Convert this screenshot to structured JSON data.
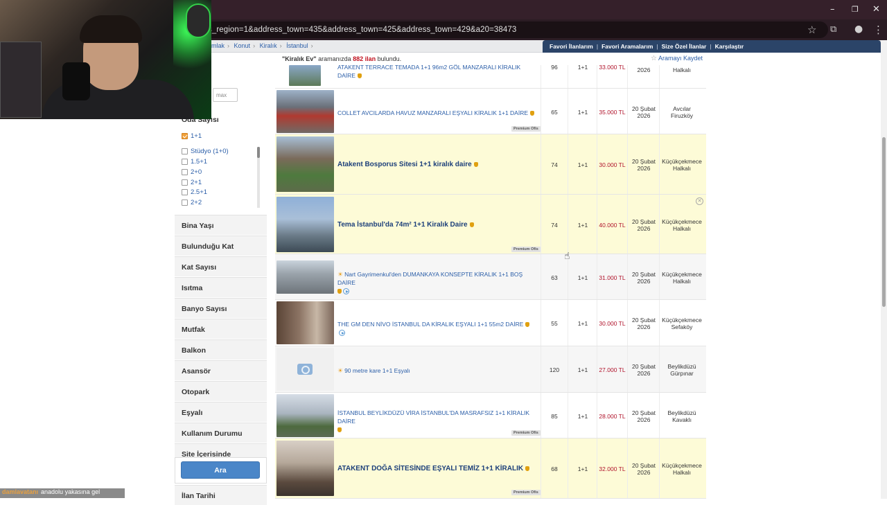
{
  "browser": {
    "url": "s_region=1&address_town=435&address_town=425&address_town=429&a20=38473",
    "icons": [
      "star-icon",
      "extensions-icon",
      "profile-icon",
      "menu-icon"
    ]
  },
  "breadcrumb": [
    "mlak",
    "Konut",
    "Kiralık",
    "İstanbul"
  ],
  "toplinks": [
    "Favori İlanlarım",
    "Favori Aramalarım",
    "Size Özel İlanlar",
    "Karşılaştır"
  ],
  "results": {
    "query": "\"Kiralık Ev\"",
    "middle": " aramanızda ",
    "count": "882 ilan",
    "suffix": " bulundu.",
    "save_label": "Aramayı Kaydet"
  },
  "filters": {
    "max_placeholder": "max",
    "oda_title": "Oda Sayısı",
    "selected": "1+1",
    "options": [
      "Stüdyo (1+0)",
      "1.5+1",
      "2+0",
      "2+1",
      "2.5+1",
      "2+2"
    ],
    "sections": [
      "Bina Yaşı",
      "Bulunduğu Kat",
      "Kat Sayısı",
      "Isıtma",
      "Banyo Sayısı",
      "Mutfak",
      "Balkon",
      "Asansör",
      "Otopark",
      "Eşyalı",
      "Kullanım Durumu",
      "Site İçerisinde",
      "İlan Tarihi"
    ],
    "search_button": "Ara"
  },
  "listings": [
    {
      "title": "ATAKENT TERRACE TEMADA 1+1 96m2 GÖL MANZARALI KİRALIK DAİRE",
      "m2": "96",
      "rooms": "1+1",
      "price": "33.000 TL",
      "date1": "",
      "date2": "2026",
      "loc1": "",
      "loc2": "Halkalı"
    },
    {
      "title": "COLLET AVCILARDA HAVUZ MANZARALI EŞYALI KİRALIK 1+1 DAİRE",
      "m2": "65",
      "rooms": "1+1",
      "price": "35.000 TL",
      "date1": "20 Şubat",
      "date2": "2026",
      "loc1": "Avcılar",
      "loc2": "Firuzköy",
      "premium": "Premium Ofis"
    },
    {
      "title": "Atakent Bosporus Sitesi 1+1 kiralık daire",
      "m2": "74",
      "rooms": "1+1",
      "price": "30.000 TL",
      "date1": "20 Şubat",
      "date2": "2026",
      "loc1": "Küçükçekmece",
      "loc2": "Halkalı"
    },
    {
      "title": "Tema İstanbul'da 74m² 1+1 Kiralık Daire",
      "m2": "74",
      "rooms": "1+1",
      "price": "40.000 TL",
      "date1": "20 Şubat",
      "date2": "2026",
      "loc1": "Küçükçekmece",
      "loc2": "Halkalı",
      "premium": "Premium Ofis"
    },
    {
      "title": "Nart Gayrimenkul'den DUMANKAYA KONSEPTE KİRALIK 1+1 BOŞ DAİRE",
      "m2": "63",
      "rooms": "1+1",
      "price": "31.000 TL",
      "date1": "20 Şubat",
      "date2": "2026",
      "loc1": "Küçükçekmece",
      "loc2": "Halkalı"
    },
    {
      "title": "THE GM DEN NİVO İSTANBUL DA KİRALIK EŞYALI 1+1 55m2 DAİRE",
      "m2": "55",
      "rooms": "1+1",
      "price": "30.000 TL",
      "date1": "20 Şubat",
      "date2": "2026",
      "loc1": "Küçükçekmece",
      "loc2": "Sefaköy"
    },
    {
      "title": "90 metre kare 1+1 Eşyalı",
      "m2": "120",
      "rooms": "1+1",
      "price": "27.000 TL",
      "date1": "20 Şubat",
      "date2": "2026",
      "loc1": "Beylikdüzü",
      "loc2": "Gürpınar"
    },
    {
      "title": "İSTANBUL BEYLİKDÜZÜ VİRA İSTANBUL'DA MASRAFSIZ 1+1 KİRALIK DAİRE",
      "m2": "85",
      "rooms": "1+1",
      "price": "28.000 TL",
      "date1": "20 Şubat",
      "date2": "2026",
      "loc1": "Beylikdüzü",
      "loc2": "Kavaklı",
      "premium": "Premium Ofis"
    },
    {
      "title": "ATAKENT DOĞA SİTESİNDE EŞYALI TEMİZ 1+1 KİRALIK",
      "m2": "68",
      "rooms": "1+1",
      "price": "32.000 TL",
      "date1": "20 Şubat",
      "date2": "2026",
      "loc1": "Küçükçekmece",
      "loc2": "Halkalı",
      "premium": "Premium Ofis"
    }
  ],
  "chat": {
    "user": "damlavatanı",
    "message": "anadolu yakasına gel"
  }
}
